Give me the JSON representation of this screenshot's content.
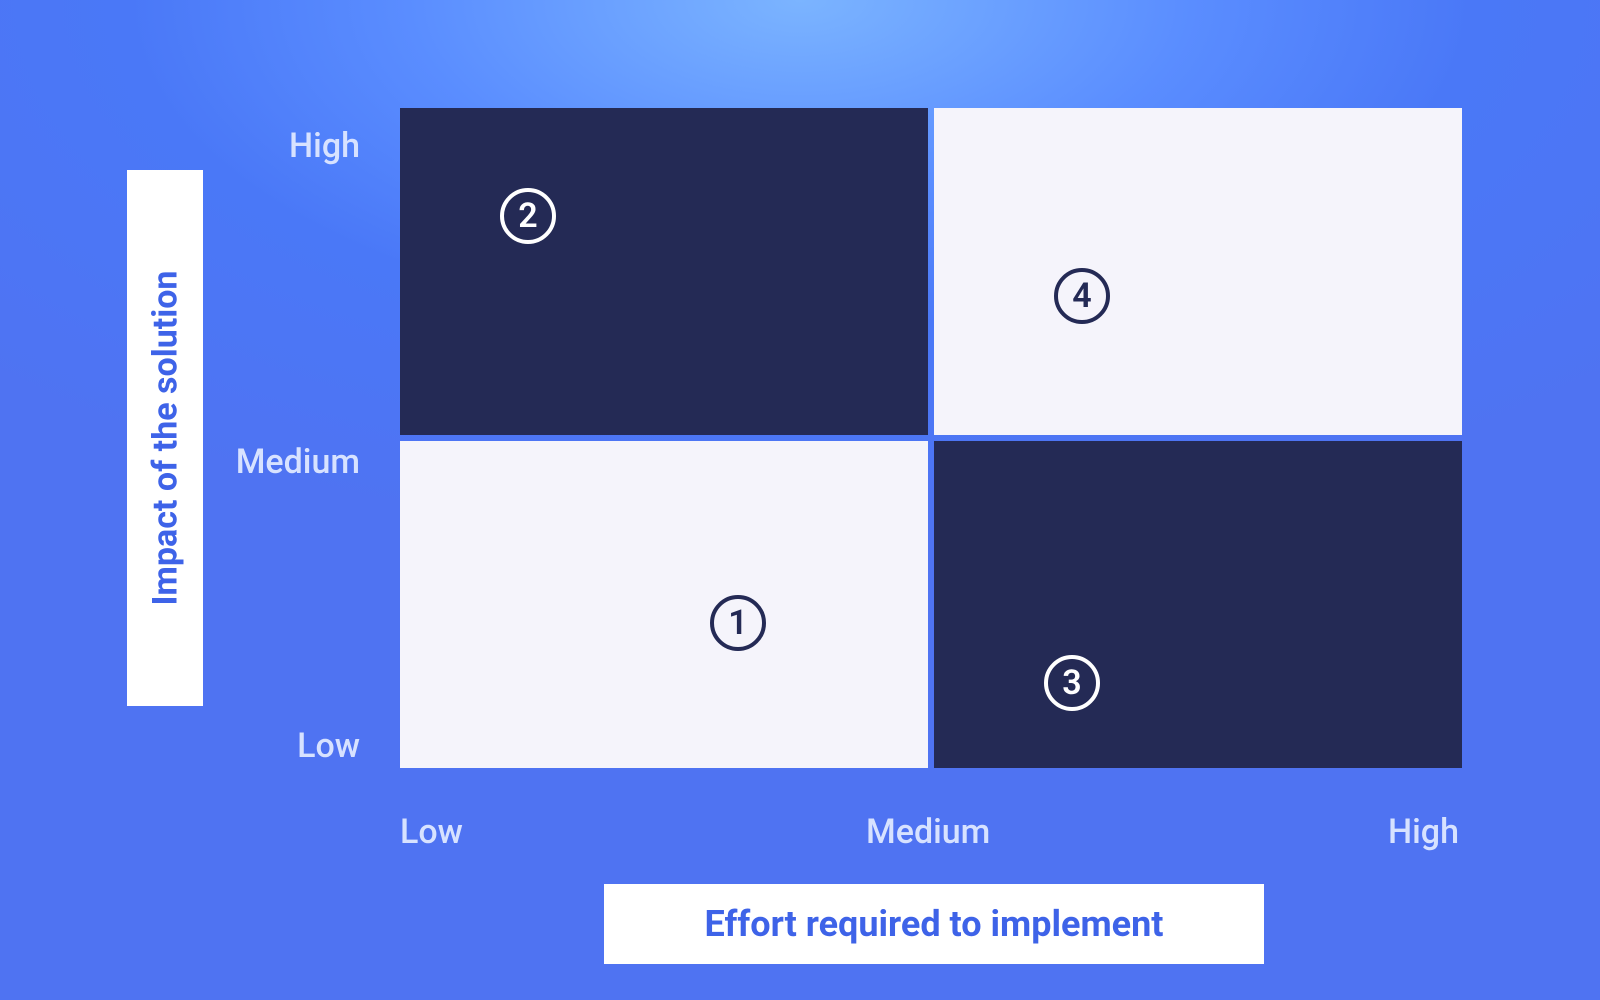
{
  "chart_data": {
    "type": "heatmap",
    "x_axis": {
      "label": "Effort required to implement",
      "ticks": [
        "Low",
        "Medium",
        "High"
      ]
    },
    "y_axis": {
      "label": "Impact of the solution",
      "ticks": [
        "Low",
        "Medium",
        "High"
      ]
    },
    "quadrants": {
      "top_left": {
        "number": "2",
        "fill": "dark",
        "x_range": [
          "Low",
          "Medium"
        ],
        "y_range": [
          "Medium",
          "High"
        ]
      },
      "top_right": {
        "number": "4",
        "fill": "light",
        "x_range": [
          "Medium",
          "High"
        ],
        "y_range": [
          "Medium",
          "High"
        ]
      },
      "bottom_left": {
        "number": "1",
        "fill": "light",
        "x_range": [
          "Low",
          "Medium"
        ],
        "y_range": [
          "Low",
          "Medium"
        ]
      },
      "bottom_right": {
        "number": "3",
        "fill": "dark",
        "x_range": [
          "Medium",
          "High"
        ],
        "y_range": [
          "Low",
          "Medium"
        ]
      }
    },
    "colors": {
      "dark": "#242a55",
      "light": "#f5f4fb",
      "accent": "#3e63e8"
    }
  }
}
